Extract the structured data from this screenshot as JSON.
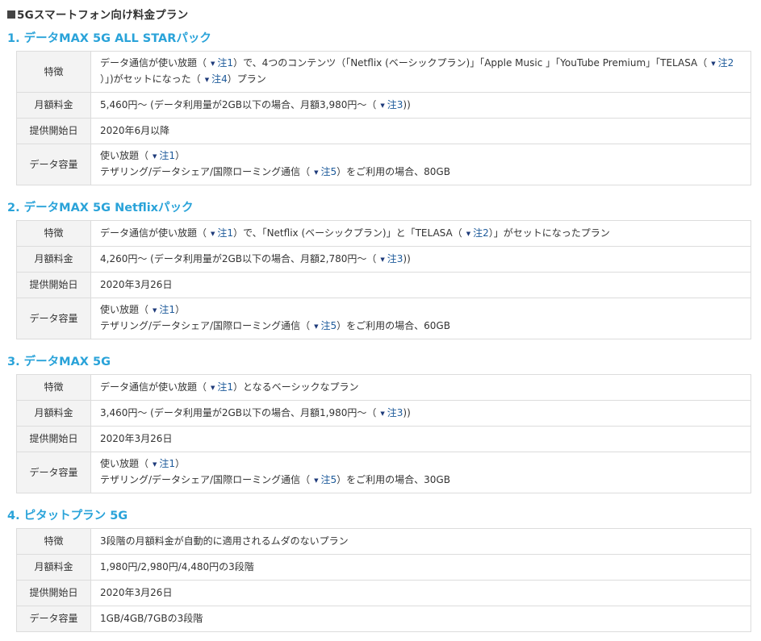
{
  "page": {
    "title": "5Gスマートフォン向け料金プラン"
  },
  "labels": {
    "feature": "特徴",
    "monthly": "月額料金",
    "start": "提供開始日",
    "capacity": "データ容量"
  },
  "notes": {
    "n1": "注1",
    "n2": "注2",
    "n3": "注3",
    "n4": "注4",
    "n5": "注5"
  },
  "icons": {
    "note": "external-link-icon"
  },
  "colors": {
    "accent": "#2aa3d9",
    "link": "#1d5a9a",
    "header_bg": "#f3f3f3",
    "border": "#dcdcdc"
  },
  "plans": [
    {
      "title": "1. データMAX 5G ALL STARパック",
      "feature": [
        "データ通信が使い放題（",
        "）で、4つのコンテンツ（「Netflix (ベーシックプラン)」「Apple Music 」「YouTube Premium」「TELASA（",
        "）」)がセットになった（",
        "）プラン"
      ],
      "monthly": [
        "5,460円〜 (データ利用量が2GB以下の場合、月額3,980円〜（",
        "))"
      ],
      "start": "2020年6月以降",
      "capacity_line1": [
        "使い放題（",
        "）"
      ],
      "capacity_line2": [
        "テザリング/データシェア/国際ローミング通信（",
        "）をご利用の場合、80GB"
      ]
    },
    {
      "title": "2. データMAX 5G Netflixパック",
      "feature": [
        "データ通信が使い放題（",
        "）で、「Netflix (ベーシックプラン)」と「TELASA（",
        "）」がセットになったプラン"
      ],
      "monthly": [
        "4,260円〜 (データ利用量が2GB以下の場合、月額2,780円〜（",
        "))"
      ],
      "start": "2020年3月26日",
      "capacity_line1": [
        "使い放題（",
        "）"
      ],
      "capacity_line2": [
        "テザリング/データシェア/国際ローミング通信（",
        "）をご利用の場合、60GB"
      ]
    },
    {
      "title": "3. データMAX 5G",
      "feature": [
        "データ通信が使い放題（",
        "）となるベーシックなプラン"
      ],
      "monthly": [
        "3,460円〜 (データ利用量が2GB以下の場合、月額1,980円〜（",
        "))"
      ],
      "start": "2020年3月26日",
      "capacity_line1": [
        "使い放題（",
        "）"
      ],
      "capacity_line2": [
        "テザリング/データシェア/国際ローミング通信（",
        "）をご利用の場合、30GB"
      ]
    },
    {
      "title": "4. ピタットプラン 5G",
      "feature": "3段階の月額料金が自動的に適用されるムダのないプラン",
      "monthly": "1,980円/2,980円/4,480円の3段階",
      "start": "2020年3月26日",
      "capacity": "1GB/4GB/7GBの3段階"
    }
  ]
}
